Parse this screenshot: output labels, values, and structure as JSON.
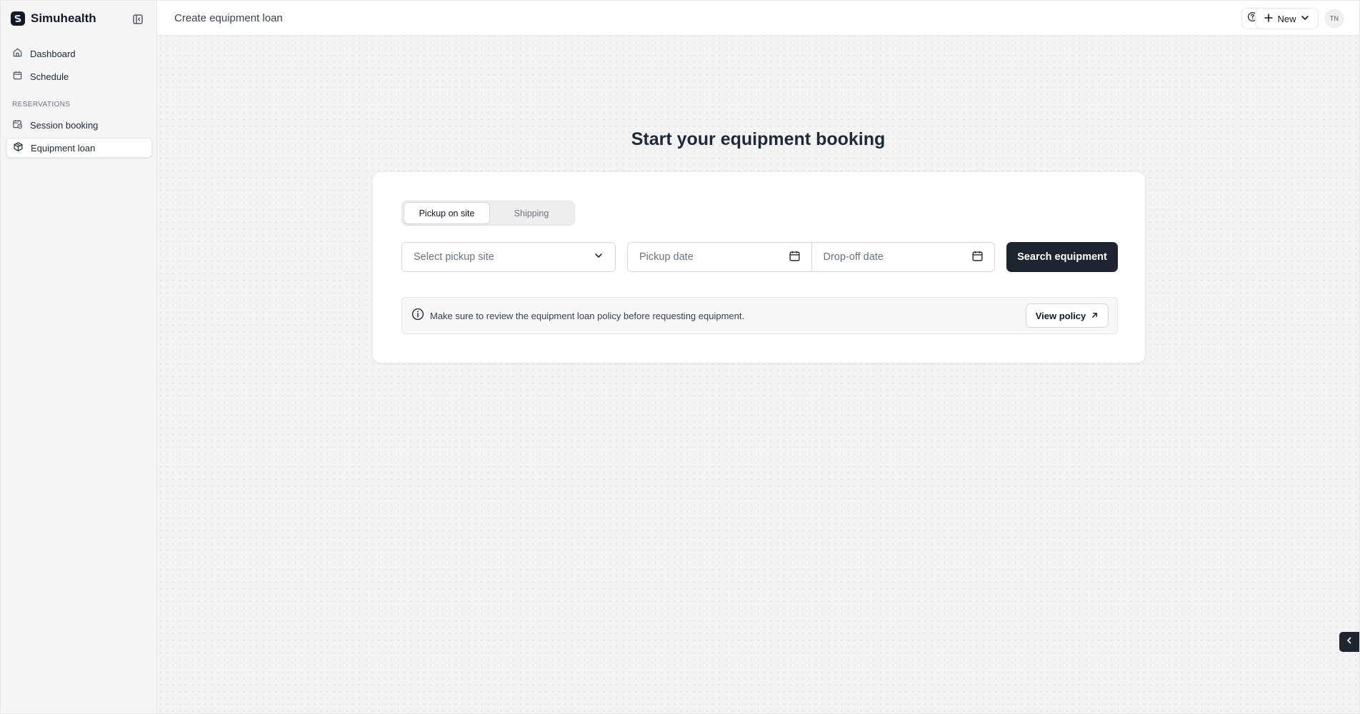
{
  "app": {
    "name": "Simuhealth"
  },
  "sidebar": {
    "items": [
      {
        "label": "Dashboard",
        "icon": "home-icon"
      },
      {
        "label": "Schedule",
        "icon": "calendar-icon"
      }
    ],
    "section_label": "RESERVATIONS",
    "reservations": [
      {
        "label": "Session booking",
        "icon": "calendar-clock-icon"
      },
      {
        "label": "Equipment loan",
        "icon": "package-icon",
        "active": true
      }
    ]
  },
  "header": {
    "title": "Create equipment loan",
    "new_label": "New",
    "avatar_initials": "TN"
  },
  "main": {
    "heading": "Start your equipment booking",
    "tabs": [
      {
        "label": "Pickup on site",
        "active": true
      },
      {
        "label": "Shipping",
        "active": false
      }
    ],
    "site_select_placeholder": "Select pickup site",
    "pickup_date_placeholder": "Pickup date",
    "dropoff_date_placeholder": "Drop-off date",
    "search_label": "Search equipment",
    "notice_text": "Make sure to review the equipment loan policy before requesting equipment.",
    "policy_label": "View policy"
  },
  "colors": {
    "primary_button": "#1e2530",
    "sidebar_bg": "#f5f5f5",
    "main_bg": "#f3f3f3"
  }
}
